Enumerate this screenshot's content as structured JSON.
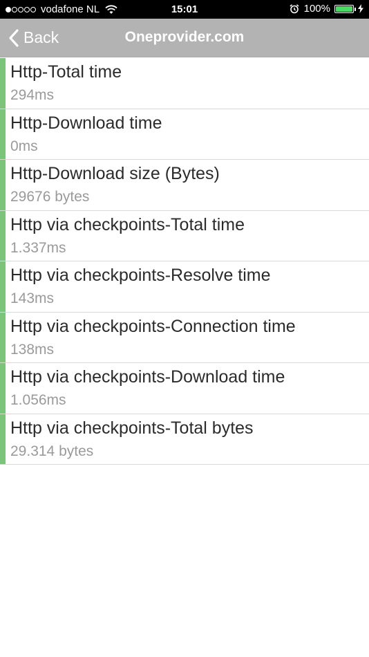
{
  "status_bar": {
    "carrier": "vodafone NL",
    "signal_bars_filled": 1,
    "signal_bars_total": 5,
    "time": "15:01",
    "battery_percent": "100%",
    "battery_level": 1.0,
    "icons": [
      "signal-dots-icon",
      "wifi-icon",
      "alarm-icon",
      "battery-icon",
      "charging-bolt-icon"
    ],
    "colors": {
      "battery_fill": "#4cd964"
    }
  },
  "nav_bar": {
    "back_label": "Back",
    "back_icon": "chevron-left-icon",
    "title": "Oneprovider.com",
    "background": "#b3b3b3"
  },
  "results": [
    {
      "title": "Http-Total time",
      "value": "294ms"
    },
    {
      "title": "Http-Download time",
      "value": "0ms"
    },
    {
      "title": "Http-Download size (Bytes)",
      "value": "29676 bytes"
    },
    {
      "title": "Http via checkpoints-Total time",
      "value": "1.337ms"
    },
    {
      "title": "Http via checkpoints-Resolve time",
      "value": "143ms"
    },
    {
      "title": "Http via checkpoints-Connection time",
      "value": "138ms"
    },
    {
      "title": "Http via checkpoints-Download time",
      "value": "1.056ms"
    },
    {
      "title": "Http via checkpoints-Total bytes",
      "value": "29.314 bytes"
    }
  ],
  "colors": {
    "accent": "#7cc47a",
    "title_text": "#2b2b2b",
    "value_text": "#9a9a9a"
  }
}
